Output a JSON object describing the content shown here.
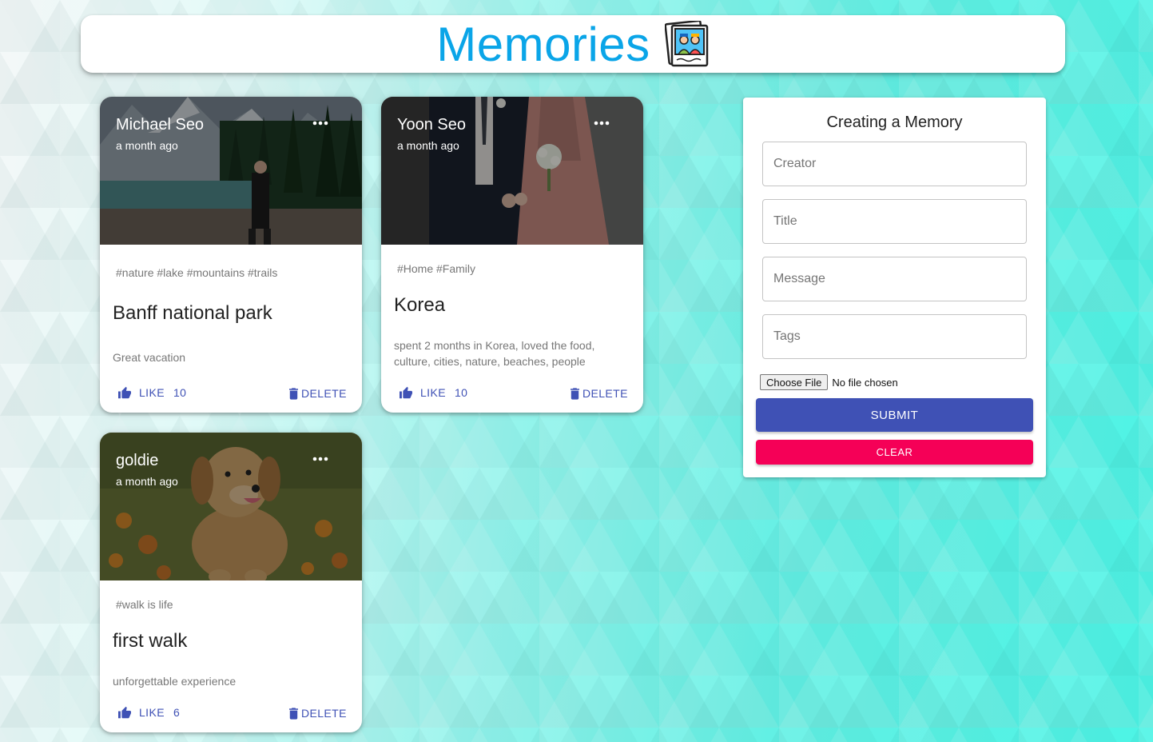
{
  "app": {
    "title": "Memories",
    "logo_icon": "family-photo-icon",
    "title_color": "#0aa5e8"
  },
  "posts": [
    {
      "creator": "Michael Seo",
      "time": "a month ago",
      "tags": "#nature #lake #mountains #trails",
      "title": "Banff national park",
      "message": "Great vacation",
      "like_label": "LIKE",
      "like_count": "10",
      "delete_label": "DELETE",
      "image": "mountain-lake-photo"
    },
    {
      "creator": "Yoon Seo",
      "time": "a month ago",
      "tags": "#Home #Family",
      "title": "Korea",
      "message": "spent 2 months in Korea, loved the food, culture, cities, nature, beaches, people",
      "like_label": "LIKE",
      "like_count": "10",
      "delete_label": "DELETE",
      "image": "wedding-couple-photo"
    },
    {
      "creator": "goldie",
      "time": "a month ago",
      "tags": "#walk is life",
      "title": "first walk",
      "message": "unforgettable experience",
      "like_label": "LIKE",
      "like_count": "6",
      "delete_label": "DELETE",
      "image": "golden-puppy-photo"
    }
  ],
  "form": {
    "heading": "Creating a Memory",
    "creator_placeholder": "Creator",
    "title_placeholder": "Title",
    "message_placeholder": "Message",
    "tags_placeholder": "Tags",
    "file_button": "Choose File",
    "file_status": "No file chosen",
    "submit_label": "SUBMIT",
    "clear_label": "CLEAR"
  },
  "colors": {
    "primary": "#3f51b5",
    "secondary": "#f50057",
    "accent": "#0aa5e8"
  }
}
